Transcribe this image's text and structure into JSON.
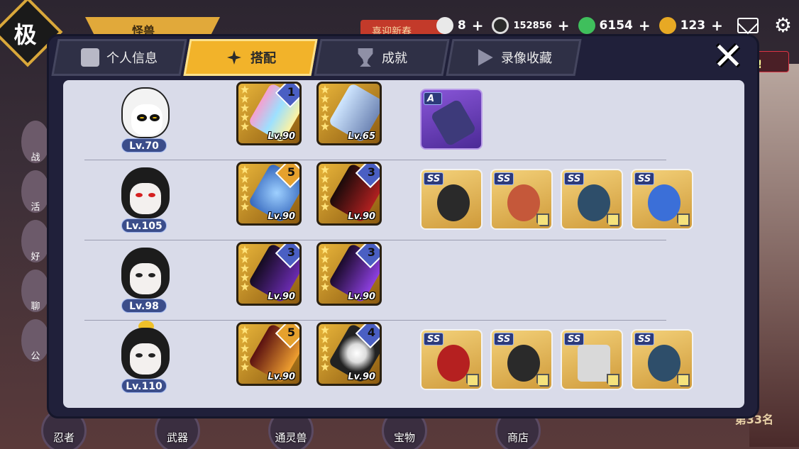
{
  "background": {
    "logo_char": "极",
    "banner_label": "怪兽",
    "event_button": "喜迎新春",
    "right_tag": "战!",
    "rank_text": "第33名",
    "side_labels": [
      "战",
      "活",
      "好",
      "聊",
      "公"
    ],
    "bottom_nav": [
      "忍者",
      "武器",
      "通灵兽",
      "宝物",
      "商店"
    ]
  },
  "currency": [
    {
      "icon": "onigiri-icon",
      "value": "8"
    },
    {
      "icon": "coin-icon",
      "value": "152856"
    },
    {
      "icon": "green-gem-icon",
      "value": "6154"
    },
    {
      "icon": "gold-drop-icon",
      "value": "123"
    }
  ],
  "tabs": [
    {
      "label": "个人信息",
      "icon": "profile-icon",
      "active": false
    },
    {
      "label": "搭配",
      "icon": "shuriken-icon",
      "active": true
    },
    {
      "label": "成就",
      "icon": "trophy-icon",
      "active": false
    },
    {
      "label": "录像收藏",
      "icon": "play-icon",
      "active": false
    }
  ],
  "rows": [
    {
      "character": "panda",
      "level": "Lv.70",
      "weapons": [
        {
          "level": "Lv.90",
          "tier": "1",
          "stars": 5
        },
        {
          "level": "Lv.65",
          "tier": "",
          "stars": 5
        }
      ],
      "items": [
        {
          "grade": "A"
        }
      ]
    },
    {
      "character": "masked-girl",
      "level": "Lv.105",
      "weapons": [
        {
          "level": "Lv.90",
          "tier": "5",
          "stars": 5
        },
        {
          "level": "Lv.90",
          "tier": "3",
          "stars": 5
        }
      ],
      "items": [
        {
          "grade": "SS"
        },
        {
          "grade": "SS"
        },
        {
          "grade": "SS"
        },
        {
          "grade": "SS"
        }
      ]
    },
    {
      "character": "spiky-ninja",
      "level": "Lv.98",
      "weapons": [
        {
          "level": "Lv.90",
          "tier": "3",
          "stars": 5
        },
        {
          "level": "Lv.90",
          "tier": "3",
          "stars": 5
        }
      ],
      "items": []
    },
    {
      "character": "duck-girl",
      "level": "Lv.110",
      "weapons": [
        {
          "level": "Lv.90",
          "tier": "5",
          "stars": 5
        },
        {
          "level": "Lv.90",
          "tier": "4",
          "stars": 5
        }
      ],
      "items": [
        {
          "grade": "SS"
        },
        {
          "grade": "SS"
        },
        {
          "grade": "SS"
        },
        {
          "grade": "SS"
        }
      ]
    }
  ]
}
